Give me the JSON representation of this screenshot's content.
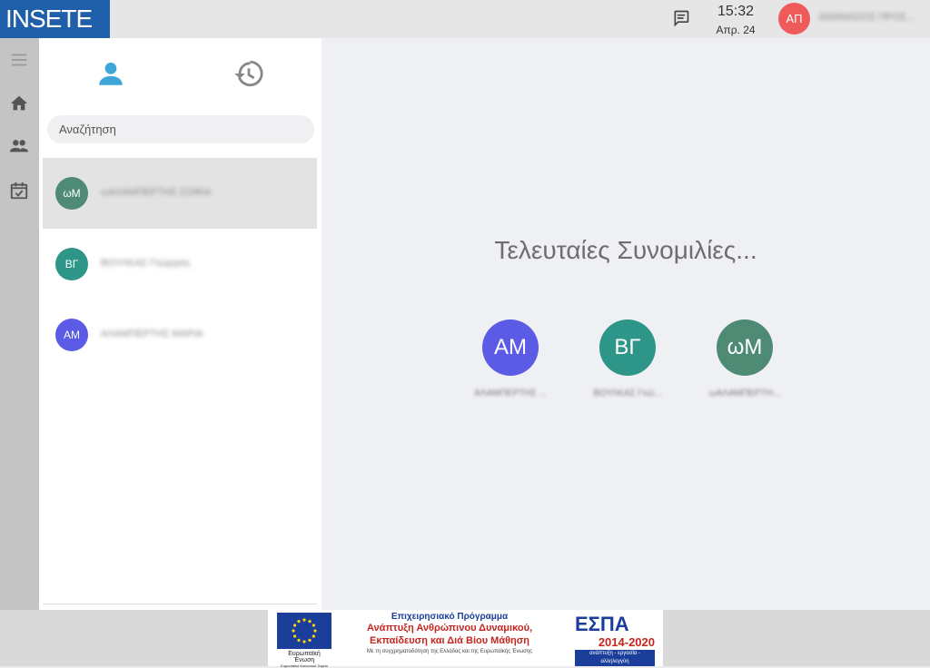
{
  "header": {
    "logo": "INSETE",
    "time": "15:32",
    "date": "Απρ. 24",
    "user_initials": "ΑΠ",
    "user_name": "ΑΘΑΝΑΣΙΟΣ ΠΡΟΣ..."
  },
  "sidebar": {
    "items": [
      {
        "icon": "menu-icon"
      },
      {
        "icon": "home-icon"
      },
      {
        "icon": "people-icon"
      },
      {
        "icon": "calendar-check-icon"
      }
    ]
  },
  "panel": {
    "tabs": [
      {
        "icon": "person-icon"
      },
      {
        "icon": "history-icon"
      }
    ],
    "search_placeholder": "Αναζήτηση",
    "contacts": [
      {
        "initials": "ωΜ",
        "name": "ωΑΛΑΜΠΕΡΤΗΣ ΣΟΦΙΑ",
        "color": "#4f8b74",
        "selected": true
      },
      {
        "initials": "ΒΓ",
        "name": "ΒΟΥΛΚΑΣ Γεώργιος",
        "color": "#2e9688",
        "selected": false
      },
      {
        "initials": "ΑΜ",
        "name": "ΑΛΑΜΠΕΡΤΗΣ ΜΑΡΙΑ",
        "color": "#5b5be5",
        "selected": false
      }
    ]
  },
  "main": {
    "heading": "Τελευταίες Συνομιλίες...",
    "recent": [
      {
        "initials": "ΑΜ",
        "name": "ΑΛΑΜΠΕΡΤΗΣ ...",
        "color": "#5b5be5"
      },
      {
        "initials": "ΒΓ",
        "name": "ΒΟΥΛΚΑΣ Γεώ...",
        "color": "#2e9688"
      },
      {
        "initials": "ωΜ",
        "name": "ωΑΛΑΜΠΕΡΤΗ...",
        "color": "#4f8b74"
      }
    ]
  },
  "footer": {
    "eu_label": "Ευρωπαϊκή Ένωση",
    "eu_sub": "Ευρωπαϊκό Κοινωνικό Ταμείο",
    "program_line1": "Επιχειρησιακό Πρόγραμμα",
    "program_line2": "Ανάπτυξη Ανθρώπινου Δυναμικού,",
    "program_line3": "Εκπαίδευση και Διά Βίου Μάθηση",
    "program_note": "Με τη συγχρηματοδότηση της Ελλάδας και της Ευρωπαϊκής Ένωσης",
    "espa_title": "ΕΣΠΑ",
    "espa_years": "2014-2020",
    "espa_tagline": "ανάπτυξη - εργασία - αλληλεγγύη"
  }
}
